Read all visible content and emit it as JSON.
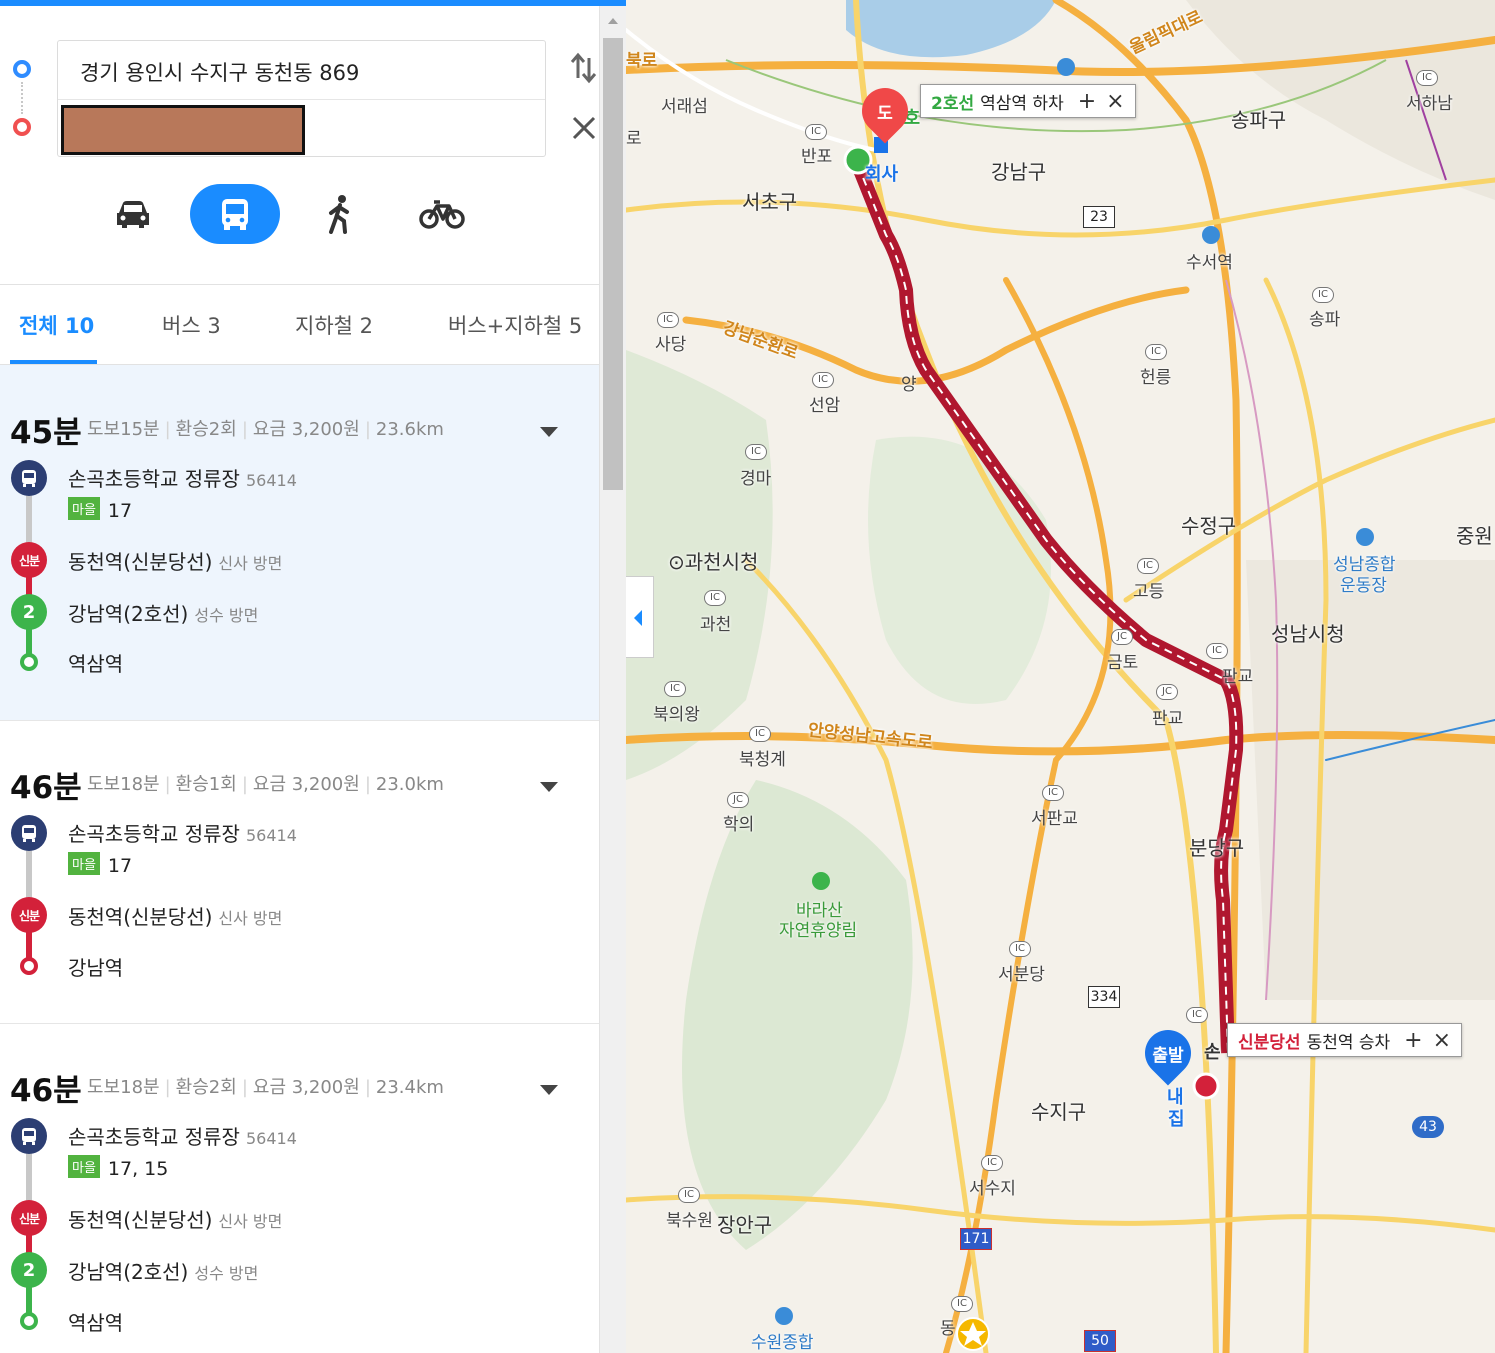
{
  "search": {
    "origin": "경기 용인시 수지구 동천동 869",
    "destination": ""
  },
  "modes": {
    "car": "car-icon",
    "transit": "bus-icon",
    "walk": "walk-icon",
    "bike": "bike-icon",
    "active": "transit"
  },
  "tabs": [
    {
      "label": "전체 10"
    },
    {
      "label": "버스 3"
    },
    {
      "label": "지하철 2"
    },
    {
      "label": "버스+지하철 5"
    }
  ],
  "routes": [
    {
      "time": "45분",
      "meta": [
        "도보15분",
        "환승2회",
        "요금 3,200원",
        "23.6km"
      ],
      "steps": [
        {
          "name": "손곡초등학교 정류장",
          "sub": "56414"
        },
        {
          "badge": "마을",
          "bus": "17"
        },
        {
          "name": "동천역(신분당선)",
          "sub": "신사 방면",
          "icon": "신분"
        },
        {
          "name": "강남역(2호선)",
          "sub": "성수 방면",
          "icon": "2"
        },
        {
          "name": "역삼역"
        }
      ]
    },
    {
      "time": "46분",
      "meta": [
        "도보18분",
        "환승1회",
        "요금 3,200원",
        "23.0km"
      ],
      "steps": [
        {
          "name": "손곡초등학교 정류장",
          "sub": "56414"
        },
        {
          "badge": "마을",
          "bus": "17"
        },
        {
          "name": "동천역(신분당선)",
          "sub": "신사 방면",
          "icon": "신분"
        },
        {
          "name": "강남역"
        }
      ]
    },
    {
      "time": "46분",
      "meta": [
        "도보18분",
        "환승2회",
        "요금 3,200원",
        "23.4km"
      ],
      "steps": [
        {
          "name": "손곡초등학교 정류장",
          "sub": "56414"
        },
        {
          "badge": "마을",
          "bus": "17, 15"
        },
        {
          "name": "동천역(신분당선)",
          "sub": "신사 방면",
          "icon": "신분"
        },
        {
          "name": "강남역(2호선)",
          "sub": "성수 방면",
          "icon": "2"
        },
        {
          "name": "역삼역"
        }
      ]
    }
  ],
  "map": {
    "popups": {
      "dest": {
        "line": "2호선",
        "text": "역삼역 하차"
      },
      "origin": {
        "line": "신분당선",
        "text": "동천역 승차"
      }
    },
    "pins": {
      "dest": "도",
      "origin": "출발"
    },
    "places": {
      "work": "회사",
      "home": "집",
      "home_prefix": "내",
      "origin_abbr": "손",
      "dest_abbr": "2호"
    },
    "labels": {
      "seorae": "서래섬",
      "banpo": "반포",
      "seocho": "서초구",
      "gangnam": "강남구",
      "songpa": "송파구",
      "seohanam": "서하남",
      "suseo": "수서역",
      "songpa_ic": "송파",
      "sadang": "사당",
      "gangnam_ring": "강남순환로",
      "yang": "양",
      "seonam": "선암",
      "heolleung": "헌릉",
      "gyeongma": "경마",
      "gwacheon_city": "과천시청",
      "gwacheon": "과천",
      "sujeong": "수정구",
      "godeung": "고등",
      "jungwon": "중원",
      "seongnam_stadium_1": "성남종합",
      "seongnam_stadium_2": "운동장",
      "seongnam_city": "성남시청",
      "geumto": "금토",
      "pangyo": "판교",
      "pangyo_ic": "판교",
      "bukuiwang": "북의왕",
      "expressway": "안양성남고속도로",
      "bukcheonggye": "북청계",
      "haguii": "학의",
      "seopangyo": "서판교",
      "bundang": "분당구",
      "barasan_1": "바라산",
      "barasan_2": "자연휴양림",
      "seobundang": "서분당",
      "suji": "수지구",
      "seosuji": "서수지",
      "buksuwon": "북수원",
      "jangan": "장안구",
      "suwon_stadium": "수원종합",
      "dong": "동",
      "olympic": "올림픽대로",
      "bukro": "북로",
      "ro": "로"
    },
    "shields": {
      "r23": "23",
      "r334": "334",
      "r43": "43",
      "r171": "171",
      "r50": "50"
    }
  }
}
